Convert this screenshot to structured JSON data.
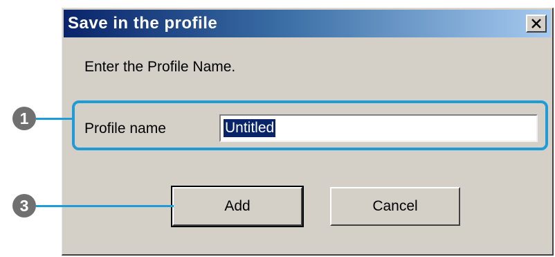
{
  "dialog": {
    "title": "Save in the profile",
    "close_glyph": "×",
    "prompt": "Enter the Profile Name.",
    "field_label": "Profile name",
    "field_value": "Untitled",
    "add_label": "Add",
    "cancel_label": "Cancel"
  },
  "callouts": {
    "marker_1": "1",
    "marker_3": "3"
  },
  "colors": {
    "title_gradient_start": "#0a246a",
    "title_gradient_end": "#a6caf0",
    "dialog_face": "#d4d0c8",
    "callout_blue": "#1f9bd7",
    "marker_gray": "#707070",
    "selection": "#0a246a"
  },
  "icons": {
    "close": "close-icon"
  }
}
